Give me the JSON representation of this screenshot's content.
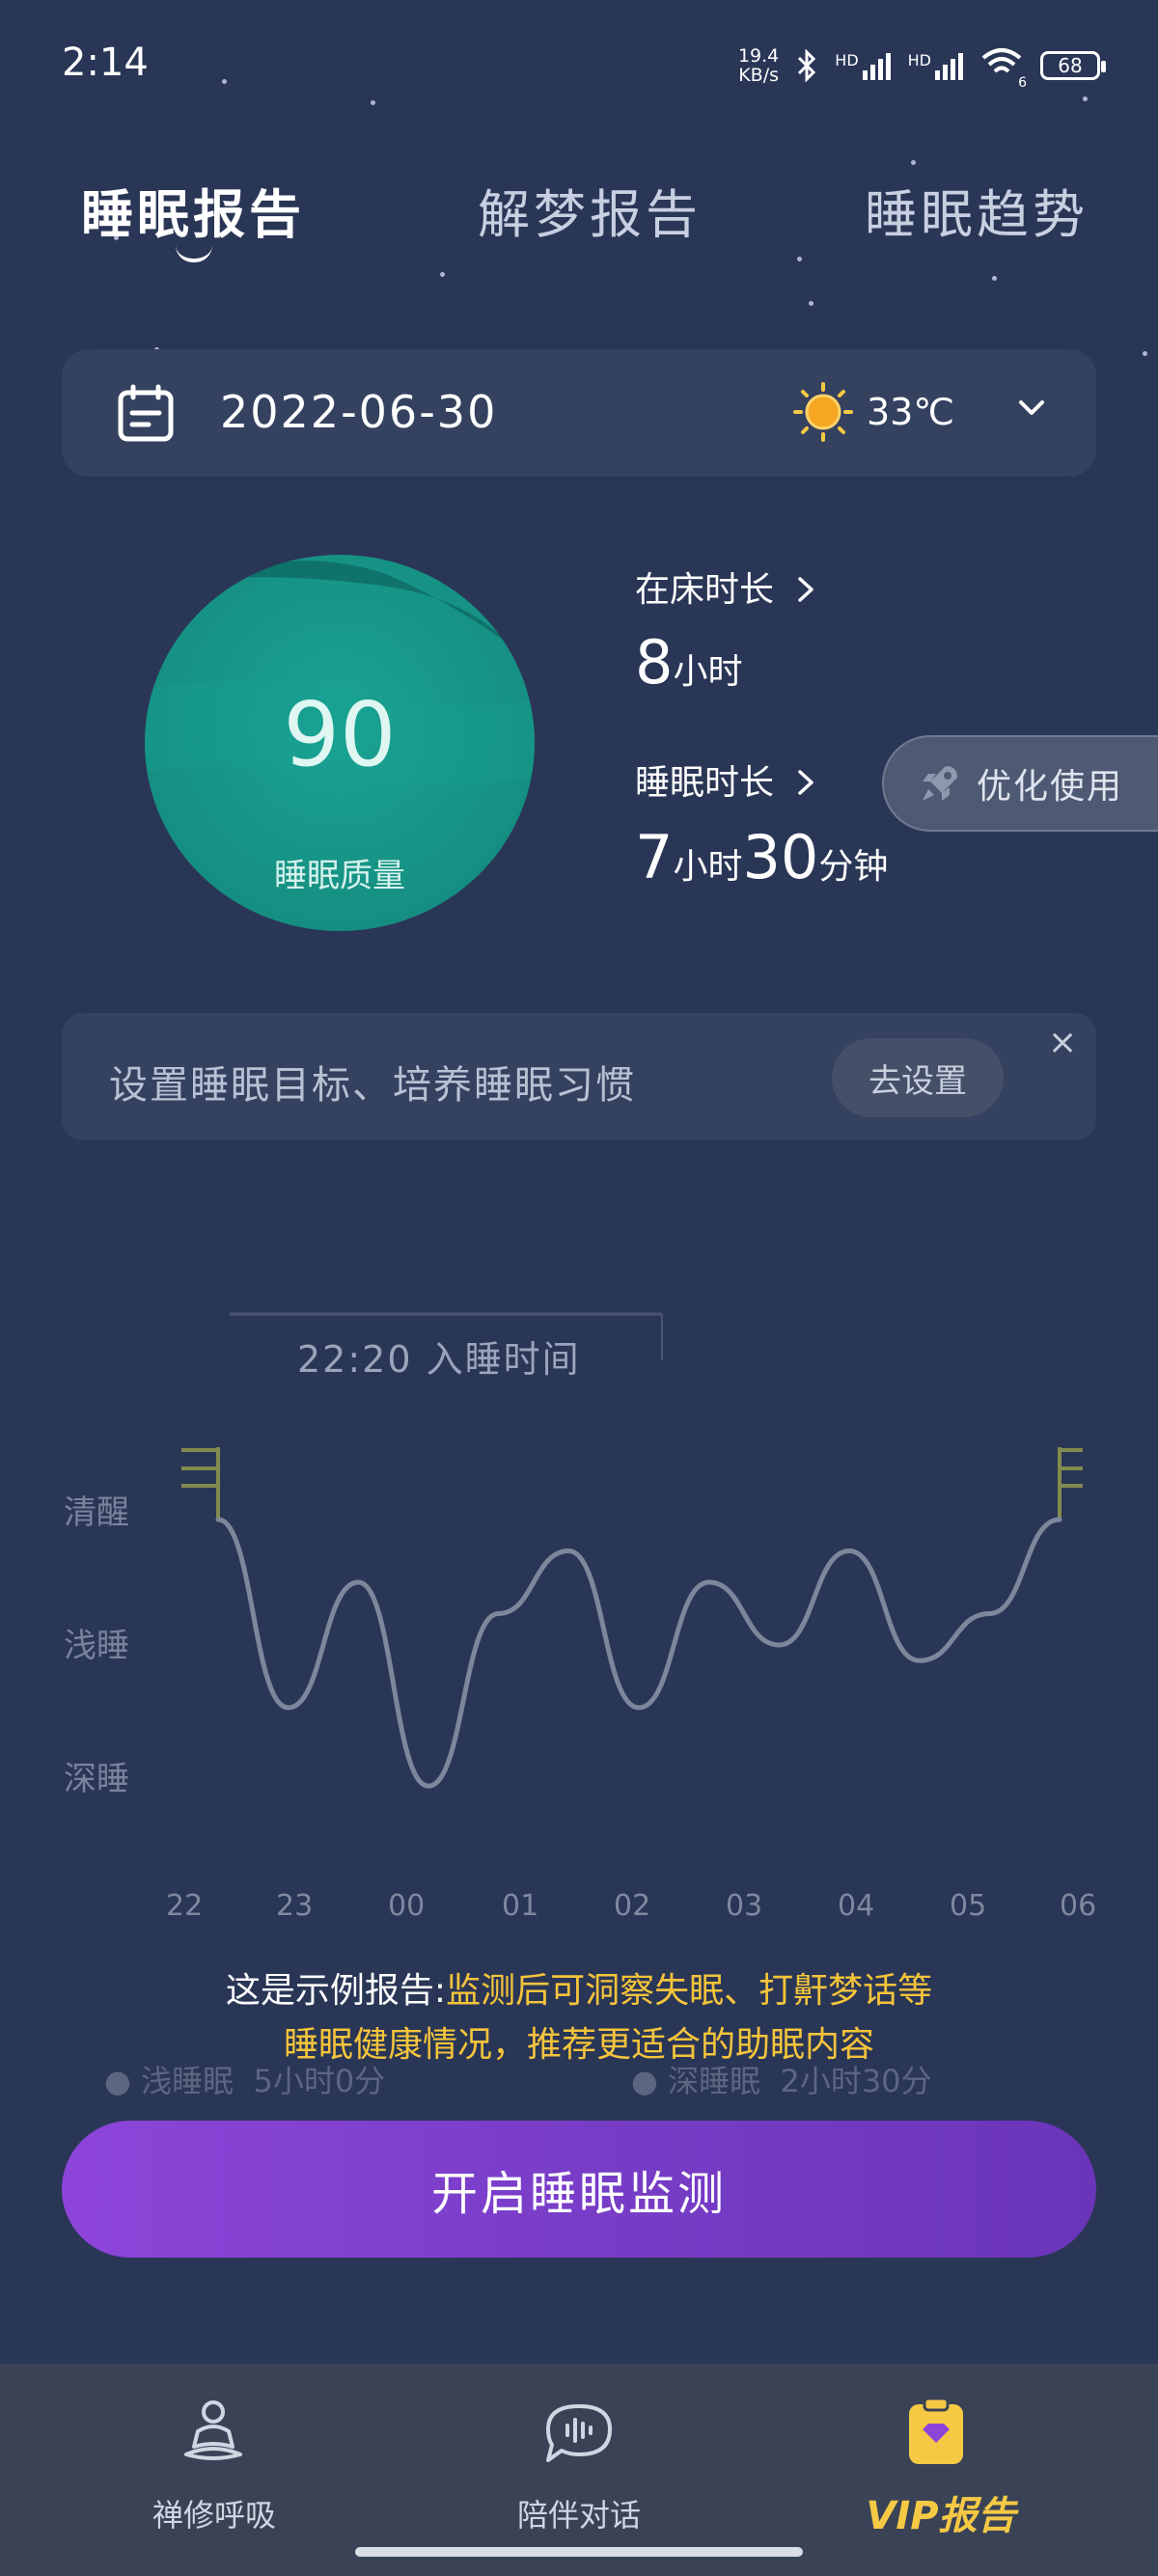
{
  "status_bar": {
    "time": "2:14",
    "net_speed_value": "19.4",
    "net_speed_unit": "KB/s",
    "hd1": "HD",
    "hd2": "HD",
    "wifi_sub": "6",
    "battery": "68"
  },
  "tabs": [
    {
      "label": "睡眠报告",
      "active": true
    },
    {
      "label": "解梦报告",
      "active": false
    },
    {
      "label": "睡眠趋势",
      "active": false
    }
  ],
  "date_bar": {
    "date": "2022-06-30",
    "temperature": "33℃",
    "icons": {
      "calendar": "calendar-icon",
      "weather": "sun-icon",
      "expand": "chevron-down-icon"
    }
  },
  "score": {
    "value": "90",
    "label": "睡眠质量"
  },
  "stats": {
    "bed_label": "在床时长",
    "bed_hours": "8",
    "bed_hours_unit": "小时",
    "sleep_label": "睡眠时长",
    "sleep_hours": "7",
    "sleep_hours_unit": "小时",
    "sleep_minutes": "30",
    "sleep_minutes_unit": "分钟"
  },
  "optimize_button": {
    "label": "优化使用"
  },
  "goal_banner": {
    "text": "设置睡眠目标、培养睡眠习惯",
    "button": "去设置",
    "close": "×"
  },
  "chart_data": {
    "type": "line",
    "title": "",
    "sleep_start": "22:20 入睡时间",
    "y_categories": [
      "清醒",
      "浅睡",
      "深睡"
    ],
    "x": [
      "22",
      "23",
      "00",
      "01",
      "02",
      "03",
      "04",
      "05",
      "06"
    ],
    "series": [
      {
        "values": [
          2.0,
          0.8,
          1.6,
          0.3,
          1.4,
          1.8,
          0.8,
          1.6,
          1.2,
          1.8,
          1.1,
          1.4,
          2.0
        ]
      }
    ],
    "colors": {
      "line": "#7d879b",
      "edge": "#9aa04e"
    }
  },
  "legend": {
    "light_label": "浅睡眠",
    "light_value": "5小时0分",
    "deep_label": "深睡眠",
    "deep_value": "2小时30分"
  },
  "notice": {
    "prefix": "这是示例报告:",
    "line1_rest": "监测后可洞察失眠、打鼾梦话等",
    "line2": "睡眠健康情况，推荐更适合的助眠内容"
  },
  "start_button": {
    "label": "开启睡眠监测"
  },
  "bottom_nav": [
    {
      "label": "禅修呼吸",
      "icon": "meditation-icon"
    },
    {
      "label": "陪伴对话",
      "icon": "chat-wave-icon"
    },
    {
      "label": "VIP报告",
      "icon": "vip-report-icon"
    }
  ],
  "theme": {
    "background": "#2a3656",
    "accent": "#8d45d9",
    "vip": "#f6c945",
    "score": "#158f82"
  }
}
